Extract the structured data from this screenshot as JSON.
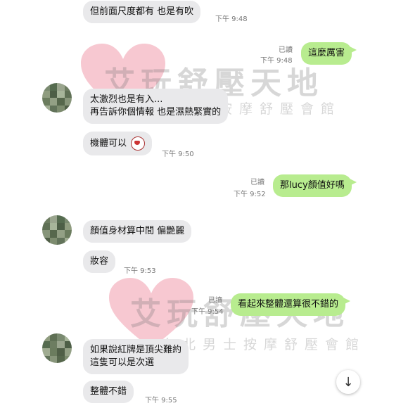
{
  "watermark": {
    "title": "艾玩舒壓天地",
    "subtitle": "台北男士按摩舒壓會館"
  },
  "messages": [
    {
      "dir": "in",
      "text": "但前面尺度都有 也是有吹",
      "time": "下午 9:48"
    },
    {
      "dir": "out",
      "text": "這麼厲害",
      "time": "下午 9:48",
      "read": "已讀"
    },
    {
      "dir": "in",
      "lines": [
        "太激烈也是有入...",
        "再告訴你個情報 也是濕熱緊實的"
      ]
    },
    {
      "dir": "in",
      "text": "機體可以",
      "time": "下午 9:50",
      "emoji": "sticker-face-icon"
    },
    {
      "dir": "out",
      "text": "那lucy顏值好嗎",
      "time": "下午 9:52",
      "read": "已讀"
    },
    {
      "dir": "in",
      "text": "顏值身材算中間  偏艷麗"
    },
    {
      "dir": "in",
      "text": "妝容",
      "time": "下午 9:53"
    },
    {
      "dir": "out",
      "text": "看起來整體還算很不錯的",
      "time": "下午 9:54",
      "read": "已讀"
    },
    {
      "dir": "in",
      "lines": [
        "如果說紅牌是頂尖難約",
        "這隻可以是次選"
      ]
    },
    {
      "dir": "in",
      "text": "整體不錯",
      "time": "下午 9:55"
    }
  ],
  "scroll_button": {
    "icon": "arrow-down-icon",
    "glyph": "↓"
  },
  "colors": {
    "incoming": "#e9e9eb",
    "outgoing": "#b8ec8f",
    "watermark_heart": "#f4b6c2"
  }
}
